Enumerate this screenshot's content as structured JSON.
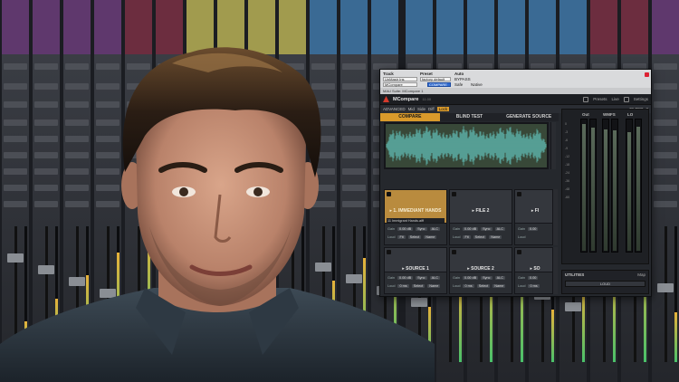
{
  "host": {
    "track_label": "Track",
    "preset_label": "Preset",
    "auto_label": "Auto",
    "track_value": "UnMastr Ins",
    "plugin_value": "MCompare",
    "preset_value": "factory default",
    "compare_label": "COMPARE",
    "bypass_label": "BYPASS",
    "safe_label": "Safe",
    "native_label": "Native",
    "title_bar": "MAU Suite: MCompare 1"
  },
  "plugin": {
    "brand": "MCompare",
    "version": "11.00",
    "presets_label": "Presets",
    "settings_label": "Settings",
    "live_label": "Live",
    "mode_label": "ADVANCED",
    "mode_options": [
      "Mid",
      "Side",
      "Diff",
      "Lock"
    ],
    "mode_selected": "Lock",
    "filter_label": "FILTER",
    "help_label": "?"
  },
  "tabs": [
    {
      "label": "COMPARE",
      "active": true
    },
    {
      "label": "BLIND TEST",
      "active": false
    },
    {
      "label": "GENERATE SOURCE",
      "active": false
    }
  ],
  "tiles_row1": [
    {
      "name": "1. IMMEDIANT HANDS",
      "active": true,
      "file": "11 Immigrant Hands.aiff",
      "gain": "0.00 dB",
      "sync": "Sync",
      "alc": "ALC",
      "fit": "Fit",
      "select": "Select",
      "name_btn": "Name"
    },
    {
      "name": "FILE 2",
      "active": false,
      "gain": "0.00 dB",
      "sync": "Sync",
      "alc": "ALC",
      "fit": "Fit",
      "select": "Select",
      "name_btn": "Name"
    },
    {
      "name": "FI",
      "active": false,
      "gain": "0.00",
      "sync": "",
      "alc": "",
      "fit": "",
      "select": "",
      "name_btn": ""
    }
  ],
  "tiles_row2": [
    {
      "name": "SOURCE 1",
      "active": false,
      "gain": "0.00 dB",
      "sync": "Sync",
      "alc": "ALC",
      "fit": "0 ms",
      "select": "Select",
      "name_btn": "Name"
    },
    {
      "name": "SOURCE 2",
      "active": false,
      "gain": "0.00 dB",
      "sync": "Sync",
      "alc": "ALC",
      "fit": "0 ms",
      "select": "Select",
      "name_btn": "Name"
    },
    {
      "name": "SO",
      "active": false,
      "gain": "0.00",
      "sync": "",
      "alc": "",
      "fit": "0 ms",
      "select": "",
      "name_btn": ""
    }
  ],
  "meters": {
    "labels": [
      "Out",
      "WMFS",
      "LO"
    ],
    "scale": [
      "0",
      "-3",
      "-6",
      "-9",
      "-12",
      "-18",
      "-24",
      "-36",
      "-48",
      "-60"
    ],
    "levels": [
      0.96,
      0.93,
      0.92,
      0.91,
      0.9,
      0.94
    ]
  },
  "utilities": {
    "title": "UTILITIES",
    "map_label": "Map",
    "button": "LOUD"
  },
  "colors": {
    "accent": "#d99a2b",
    "waveform": "#5aa9a0",
    "brand_red": "#d43a2c"
  }
}
